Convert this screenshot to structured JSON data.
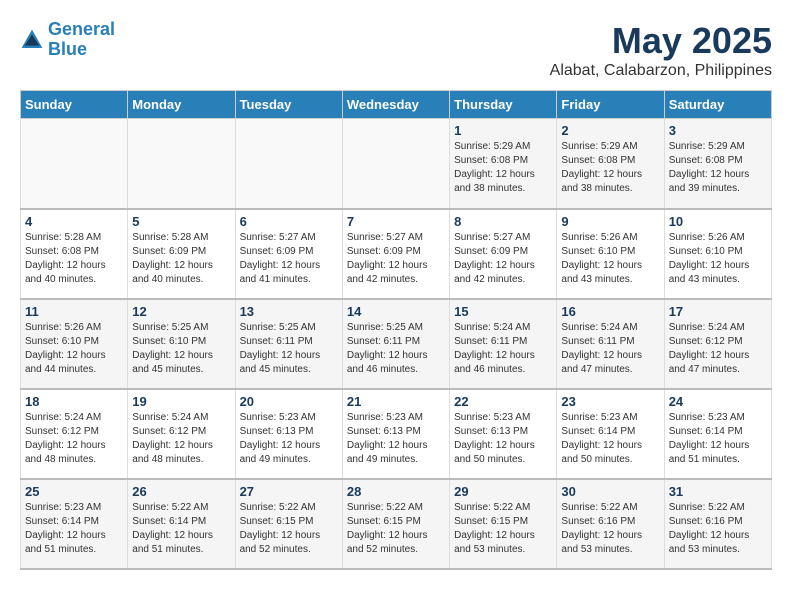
{
  "header": {
    "logo_line1": "General",
    "logo_line2": "Blue",
    "title": "May 2025",
    "subtitle": "Alabat, Calabarzon, Philippines"
  },
  "weekdays": [
    "Sunday",
    "Monday",
    "Tuesday",
    "Wednesday",
    "Thursday",
    "Friday",
    "Saturday"
  ],
  "weeks": [
    [
      {
        "day": "",
        "info": ""
      },
      {
        "day": "",
        "info": ""
      },
      {
        "day": "",
        "info": ""
      },
      {
        "day": "",
        "info": ""
      },
      {
        "day": "1",
        "info": "Sunrise: 5:29 AM\nSunset: 6:08 PM\nDaylight: 12 hours\nand 38 minutes."
      },
      {
        "day": "2",
        "info": "Sunrise: 5:29 AM\nSunset: 6:08 PM\nDaylight: 12 hours\nand 38 minutes."
      },
      {
        "day": "3",
        "info": "Sunrise: 5:29 AM\nSunset: 6:08 PM\nDaylight: 12 hours\nand 39 minutes."
      }
    ],
    [
      {
        "day": "4",
        "info": "Sunrise: 5:28 AM\nSunset: 6:08 PM\nDaylight: 12 hours\nand 40 minutes."
      },
      {
        "day": "5",
        "info": "Sunrise: 5:28 AM\nSunset: 6:09 PM\nDaylight: 12 hours\nand 40 minutes."
      },
      {
        "day": "6",
        "info": "Sunrise: 5:27 AM\nSunset: 6:09 PM\nDaylight: 12 hours\nand 41 minutes."
      },
      {
        "day": "7",
        "info": "Sunrise: 5:27 AM\nSunset: 6:09 PM\nDaylight: 12 hours\nand 42 minutes."
      },
      {
        "day": "8",
        "info": "Sunrise: 5:27 AM\nSunset: 6:09 PM\nDaylight: 12 hours\nand 42 minutes."
      },
      {
        "day": "9",
        "info": "Sunrise: 5:26 AM\nSunset: 6:10 PM\nDaylight: 12 hours\nand 43 minutes."
      },
      {
        "day": "10",
        "info": "Sunrise: 5:26 AM\nSunset: 6:10 PM\nDaylight: 12 hours\nand 43 minutes."
      }
    ],
    [
      {
        "day": "11",
        "info": "Sunrise: 5:26 AM\nSunset: 6:10 PM\nDaylight: 12 hours\nand 44 minutes."
      },
      {
        "day": "12",
        "info": "Sunrise: 5:25 AM\nSunset: 6:10 PM\nDaylight: 12 hours\nand 45 minutes."
      },
      {
        "day": "13",
        "info": "Sunrise: 5:25 AM\nSunset: 6:11 PM\nDaylight: 12 hours\nand 45 minutes."
      },
      {
        "day": "14",
        "info": "Sunrise: 5:25 AM\nSunset: 6:11 PM\nDaylight: 12 hours\nand 46 minutes."
      },
      {
        "day": "15",
        "info": "Sunrise: 5:24 AM\nSunset: 6:11 PM\nDaylight: 12 hours\nand 46 minutes."
      },
      {
        "day": "16",
        "info": "Sunrise: 5:24 AM\nSunset: 6:11 PM\nDaylight: 12 hours\nand 47 minutes."
      },
      {
        "day": "17",
        "info": "Sunrise: 5:24 AM\nSunset: 6:12 PM\nDaylight: 12 hours\nand 47 minutes."
      }
    ],
    [
      {
        "day": "18",
        "info": "Sunrise: 5:24 AM\nSunset: 6:12 PM\nDaylight: 12 hours\nand 48 minutes."
      },
      {
        "day": "19",
        "info": "Sunrise: 5:24 AM\nSunset: 6:12 PM\nDaylight: 12 hours\nand 48 minutes."
      },
      {
        "day": "20",
        "info": "Sunrise: 5:23 AM\nSunset: 6:13 PM\nDaylight: 12 hours\nand 49 minutes."
      },
      {
        "day": "21",
        "info": "Sunrise: 5:23 AM\nSunset: 6:13 PM\nDaylight: 12 hours\nand 49 minutes."
      },
      {
        "day": "22",
        "info": "Sunrise: 5:23 AM\nSunset: 6:13 PM\nDaylight: 12 hours\nand 50 minutes."
      },
      {
        "day": "23",
        "info": "Sunrise: 5:23 AM\nSunset: 6:14 PM\nDaylight: 12 hours\nand 50 minutes."
      },
      {
        "day": "24",
        "info": "Sunrise: 5:23 AM\nSunset: 6:14 PM\nDaylight: 12 hours\nand 51 minutes."
      }
    ],
    [
      {
        "day": "25",
        "info": "Sunrise: 5:23 AM\nSunset: 6:14 PM\nDaylight: 12 hours\nand 51 minutes."
      },
      {
        "day": "26",
        "info": "Sunrise: 5:22 AM\nSunset: 6:14 PM\nDaylight: 12 hours\nand 51 minutes."
      },
      {
        "day": "27",
        "info": "Sunrise: 5:22 AM\nSunset: 6:15 PM\nDaylight: 12 hours\nand 52 minutes."
      },
      {
        "day": "28",
        "info": "Sunrise: 5:22 AM\nSunset: 6:15 PM\nDaylight: 12 hours\nand 52 minutes."
      },
      {
        "day": "29",
        "info": "Sunrise: 5:22 AM\nSunset: 6:15 PM\nDaylight: 12 hours\nand 53 minutes."
      },
      {
        "day": "30",
        "info": "Sunrise: 5:22 AM\nSunset: 6:16 PM\nDaylight: 12 hours\nand 53 minutes."
      },
      {
        "day": "31",
        "info": "Sunrise: 5:22 AM\nSunset: 6:16 PM\nDaylight: 12 hours\nand 53 minutes."
      }
    ]
  ]
}
